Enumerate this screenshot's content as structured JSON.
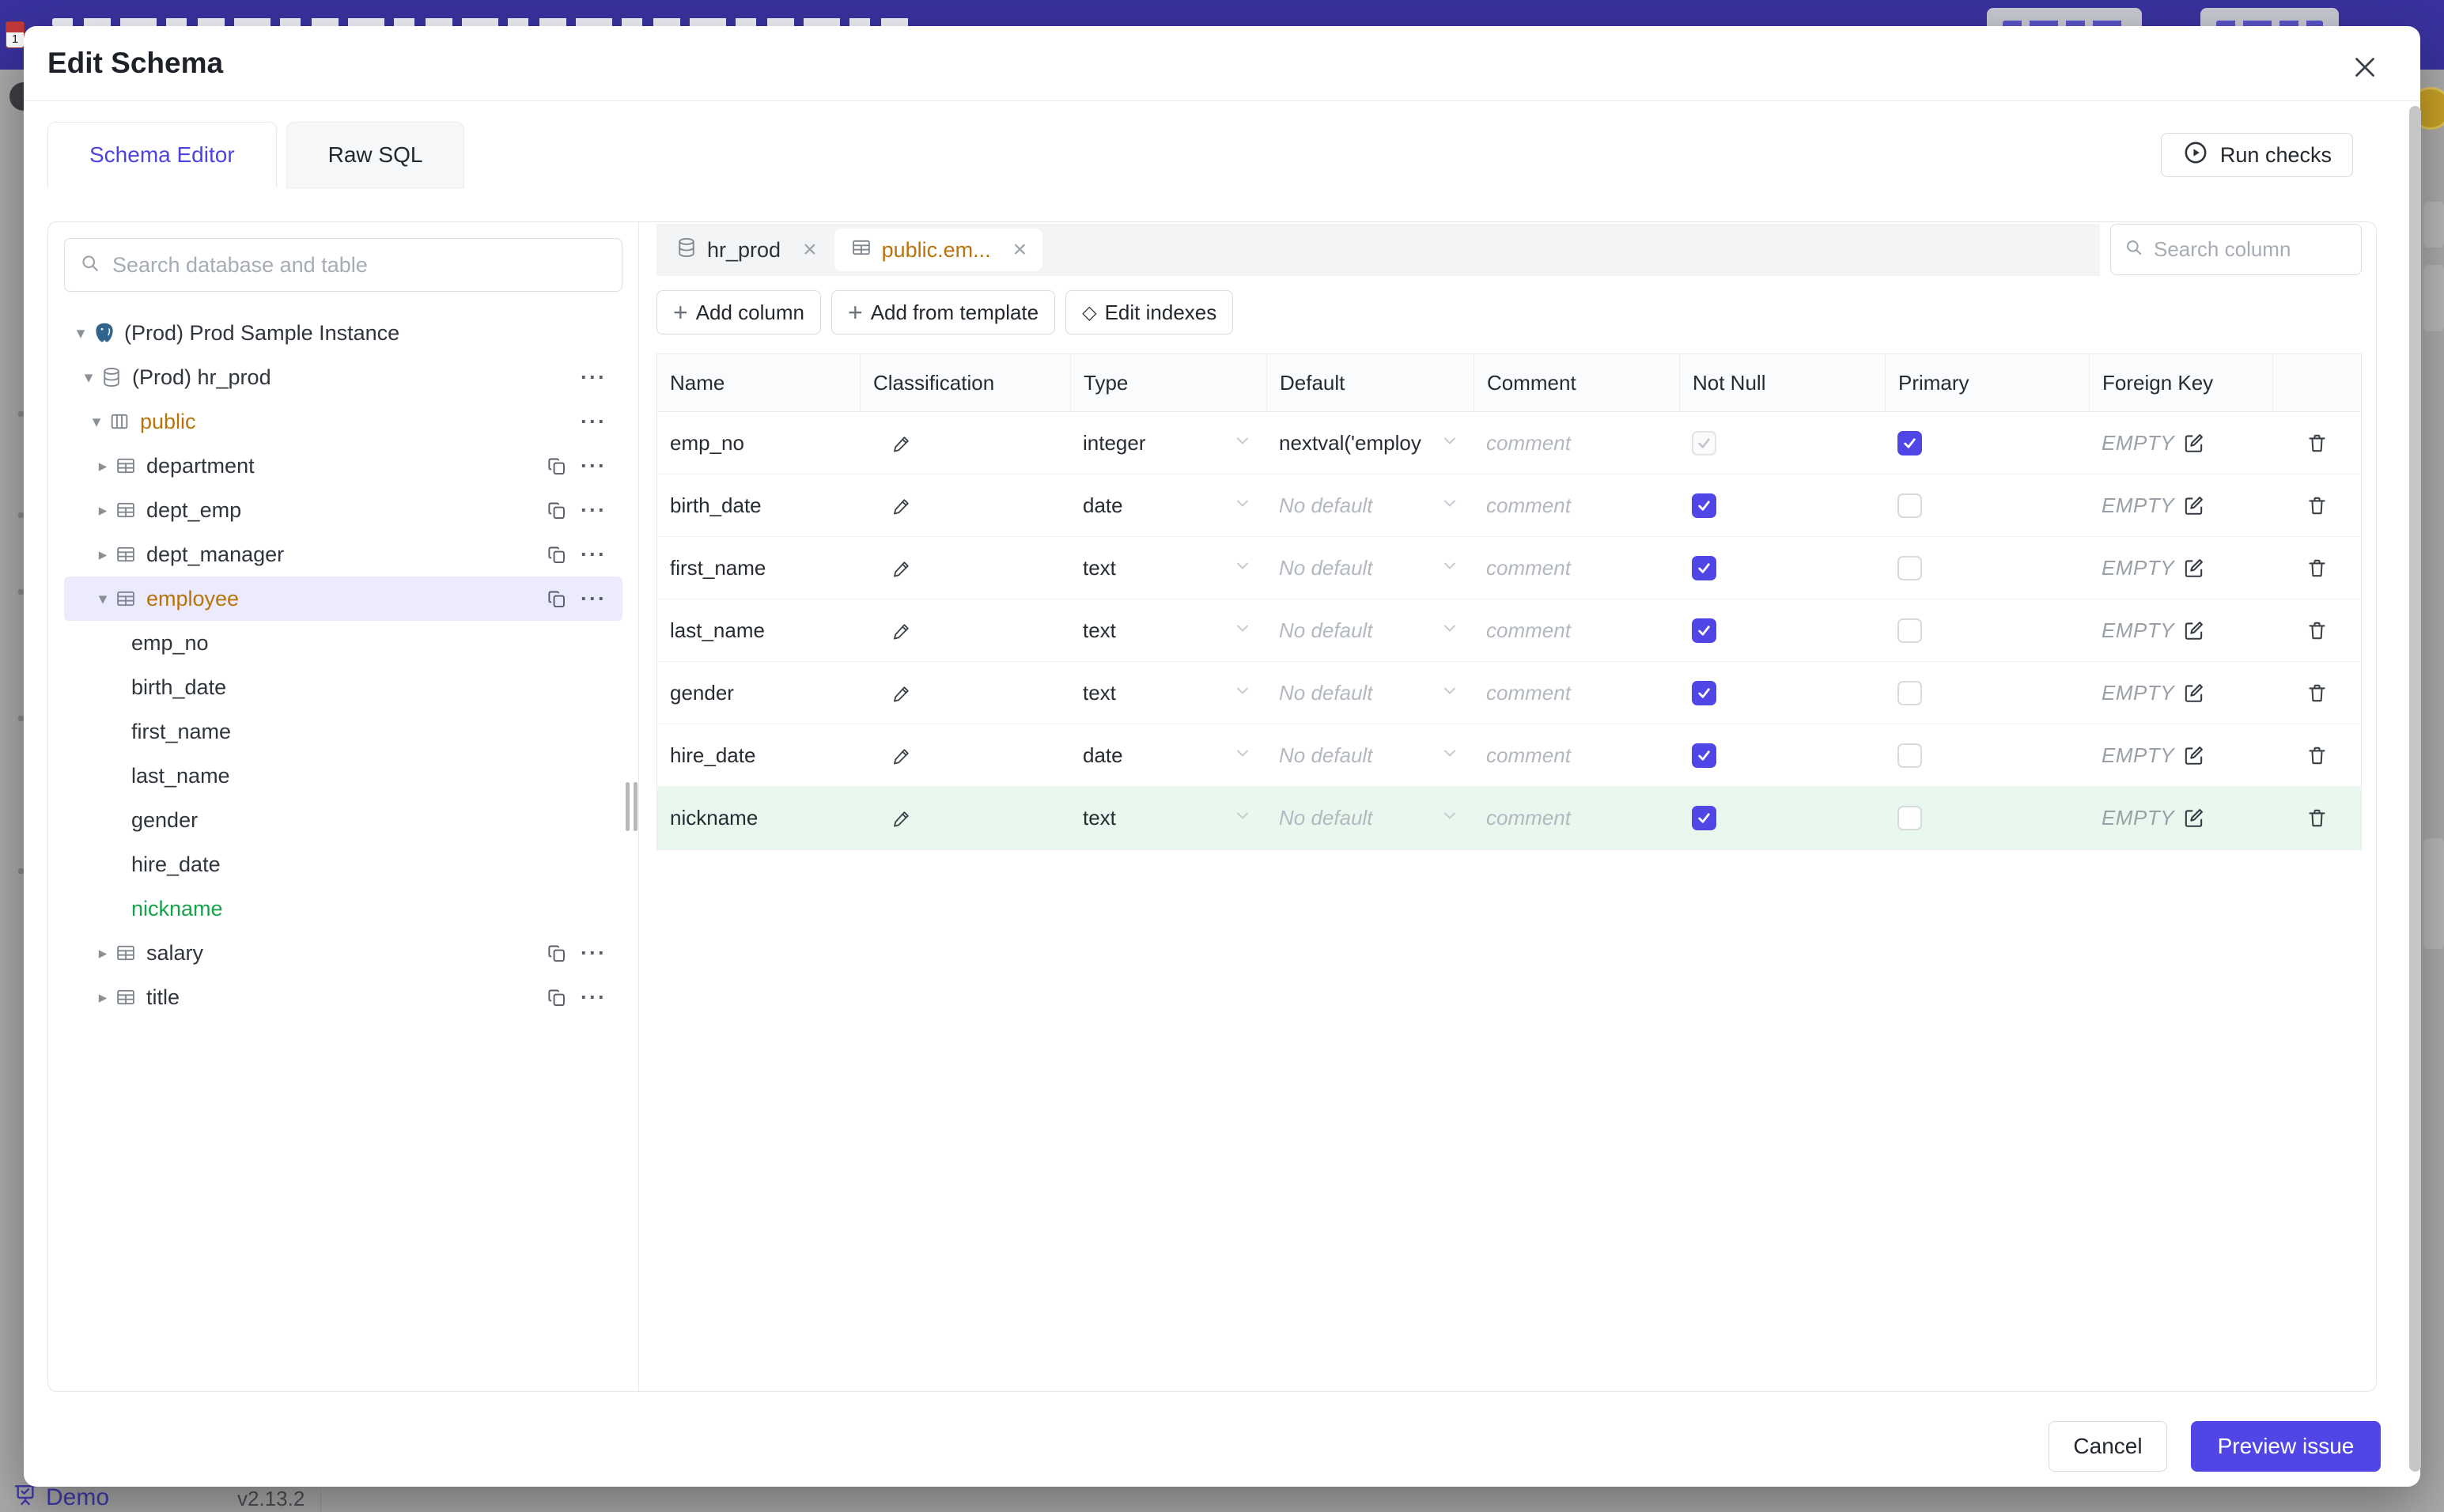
{
  "colors": {
    "accent": "#4F46E5",
    "changed_orange": "#B9730B",
    "added_green": "#16A34A",
    "banner_indigo": "#39329F",
    "added_row_bg": "#E9F8EE"
  },
  "banner": {
    "calendar_day": "1"
  },
  "modal": {
    "title": "Edit Schema"
  },
  "tabs": {
    "schema_editor": "Schema Editor",
    "raw_sql": "Raw SQL"
  },
  "toolbar": {
    "run_checks": "Run checks"
  },
  "sidebar": {
    "search_placeholder": "Search database and table",
    "tree": [
      {
        "level": 0,
        "label": "(Prod) Prod Sample Instance",
        "icon": "postgres",
        "expander": "down"
      },
      {
        "level": 1,
        "label": "(Prod) hr_prod",
        "icon": "database",
        "expander": "down",
        "menu": true
      },
      {
        "level": 2,
        "label": "public",
        "icon": "schema",
        "expander": "down",
        "menu": true,
        "state": "changed"
      },
      {
        "level": 3,
        "label": "department",
        "icon": "table",
        "expander": "right",
        "copy": true,
        "menu": true
      },
      {
        "level": 3,
        "label": "dept_emp",
        "icon": "table",
        "expander": "right",
        "copy": true,
        "menu": true
      },
      {
        "level": 3,
        "label": "dept_manager",
        "icon": "table",
        "expander": "right",
        "copy": true,
        "menu": true
      },
      {
        "level": 3,
        "label": "employee",
        "icon": "table",
        "expander": "down",
        "copy": true,
        "menu": true,
        "state": "changed",
        "selected": true
      },
      {
        "level": 4,
        "label": "emp_no"
      },
      {
        "level": 4,
        "label": "birth_date"
      },
      {
        "level": 4,
        "label": "first_name"
      },
      {
        "level": 4,
        "label": "last_name"
      },
      {
        "level": 4,
        "label": "gender"
      },
      {
        "level": 4,
        "label": "hire_date"
      },
      {
        "level": 4,
        "label": "nickname",
        "state": "added"
      },
      {
        "level": 3,
        "label": "salary",
        "icon": "table",
        "expander": "right",
        "copy": true,
        "menu": true
      },
      {
        "level": 3,
        "label": "title",
        "icon": "table",
        "expander": "right",
        "copy": true,
        "menu": true
      }
    ]
  },
  "editor": {
    "chips": [
      {
        "label": "hr_prod",
        "icon": "database",
        "active": false
      },
      {
        "label": "public.em...",
        "icon": "table",
        "active": true
      }
    ],
    "column_search_placeholder": "Search column",
    "actions": [
      {
        "label": "Add column",
        "icon": "plus"
      },
      {
        "label": "Add from template",
        "icon": "plus"
      },
      {
        "label": "Edit indexes",
        "icon": "diamond"
      }
    ],
    "table": {
      "headers": [
        "Name",
        "Classification",
        "Type",
        "Default",
        "Comment",
        "Not Null",
        "Primary",
        "Foreign Key"
      ],
      "comment_placeholder": "comment",
      "foreign_key_empty": "EMPTY",
      "rows": [
        {
          "name": "emp_no",
          "type": "integer",
          "default": "nextval('employ",
          "has_default": true,
          "not_null": "disabled-checked",
          "primary": "checked",
          "added": false
        },
        {
          "name": "birth_date",
          "type": "date",
          "default": "No default",
          "has_default": false,
          "not_null": "checked",
          "primary": "unchecked",
          "added": false
        },
        {
          "name": "first_name",
          "type": "text",
          "default": "No default",
          "has_default": false,
          "not_null": "checked",
          "primary": "unchecked",
          "added": false
        },
        {
          "name": "last_name",
          "type": "text",
          "default": "No default",
          "has_default": false,
          "not_null": "checked",
          "primary": "unchecked",
          "added": false
        },
        {
          "name": "gender",
          "type": "text",
          "default": "No default",
          "has_default": false,
          "not_null": "checked",
          "primary": "unchecked",
          "added": false
        },
        {
          "name": "hire_date",
          "type": "date",
          "default": "No default",
          "has_default": false,
          "not_null": "checked",
          "primary": "unchecked",
          "added": false
        },
        {
          "name": "nickname",
          "type": "text",
          "default": "No default",
          "has_default": false,
          "not_null": "checked",
          "primary": "unchecked",
          "added": true
        }
      ]
    }
  },
  "footer": {
    "cancel": "Cancel",
    "submit": "Preview issue"
  },
  "statusbar": {
    "brand": "Demo",
    "version": "v2.13.2"
  }
}
